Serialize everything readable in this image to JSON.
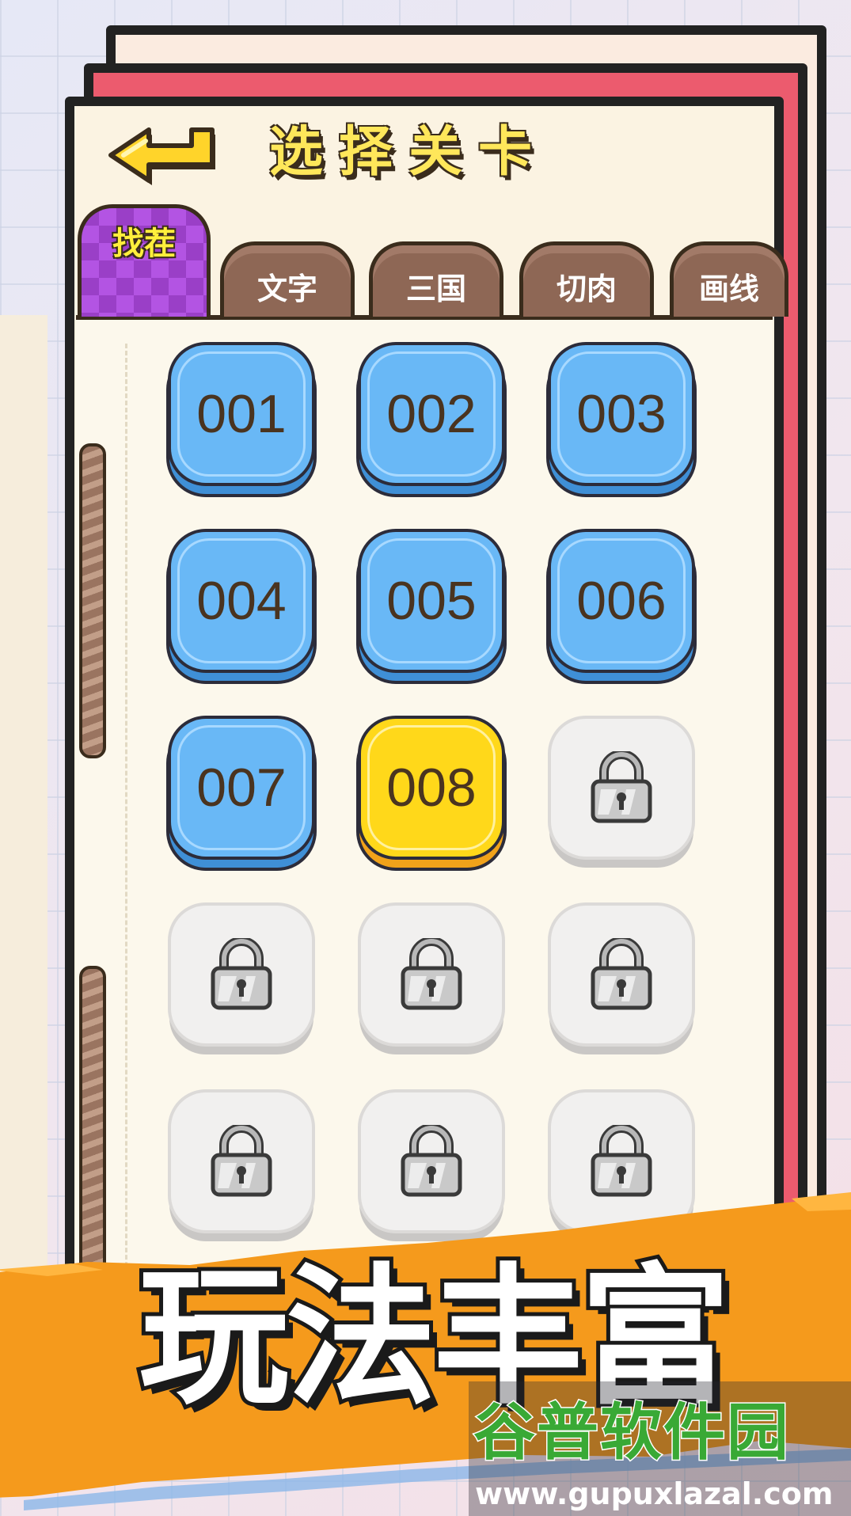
{
  "header": {
    "title": "选择关卡",
    "back_icon": "back-arrow-icon"
  },
  "tabs": [
    {
      "label": "找茬",
      "active": true
    },
    {
      "label": "文字",
      "active": false
    },
    {
      "label": "三国",
      "active": false
    },
    {
      "label": "切肉",
      "active": false
    },
    {
      "label": "画线",
      "active": false
    }
  ],
  "levels": [
    {
      "label": "001",
      "state": "unlocked"
    },
    {
      "label": "002",
      "state": "unlocked"
    },
    {
      "label": "003",
      "state": "unlocked"
    },
    {
      "label": "004",
      "state": "unlocked"
    },
    {
      "label": "005",
      "state": "unlocked"
    },
    {
      "label": "006",
      "state": "unlocked"
    },
    {
      "label": "007",
      "state": "unlocked"
    },
    {
      "label": "008",
      "state": "current"
    },
    {
      "label": "",
      "state": "locked",
      "icon": "lock-icon"
    },
    {
      "label": "",
      "state": "locked",
      "icon": "lock-icon"
    },
    {
      "label": "",
      "state": "locked",
      "icon": "lock-icon"
    },
    {
      "label": "",
      "state": "locked",
      "icon": "lock-icon"
    },
    {
      "label": "",
      "state": "locked",
      "icon": "lock-icon"
    },
    {
      "label": "",
      "state": "locked",
      "icon": "lock-icon"
    },
    {
      "label": "",
      "state": "locked",
      "icon": "lock-icon"
    }
  ],
  "promo": {
    "banner_text": "玩法丰富"
  },
  "watermark": {
    "logo_text": "谷普软件园",
    "url": "www.gupuxlazal.com"
  },
  "colors": {
    "unlocked_tile": "#69b8f6",
    "current_tile": "#ffd81a",
    "locked_tile": "#f1f0ef",
    "active_tab": "#9a3fc7",
    "inactive_tab": "#8e6755",
    "title_text": "#ffe75a",
    "banner_orange": "#f59a1c"
  }
}
